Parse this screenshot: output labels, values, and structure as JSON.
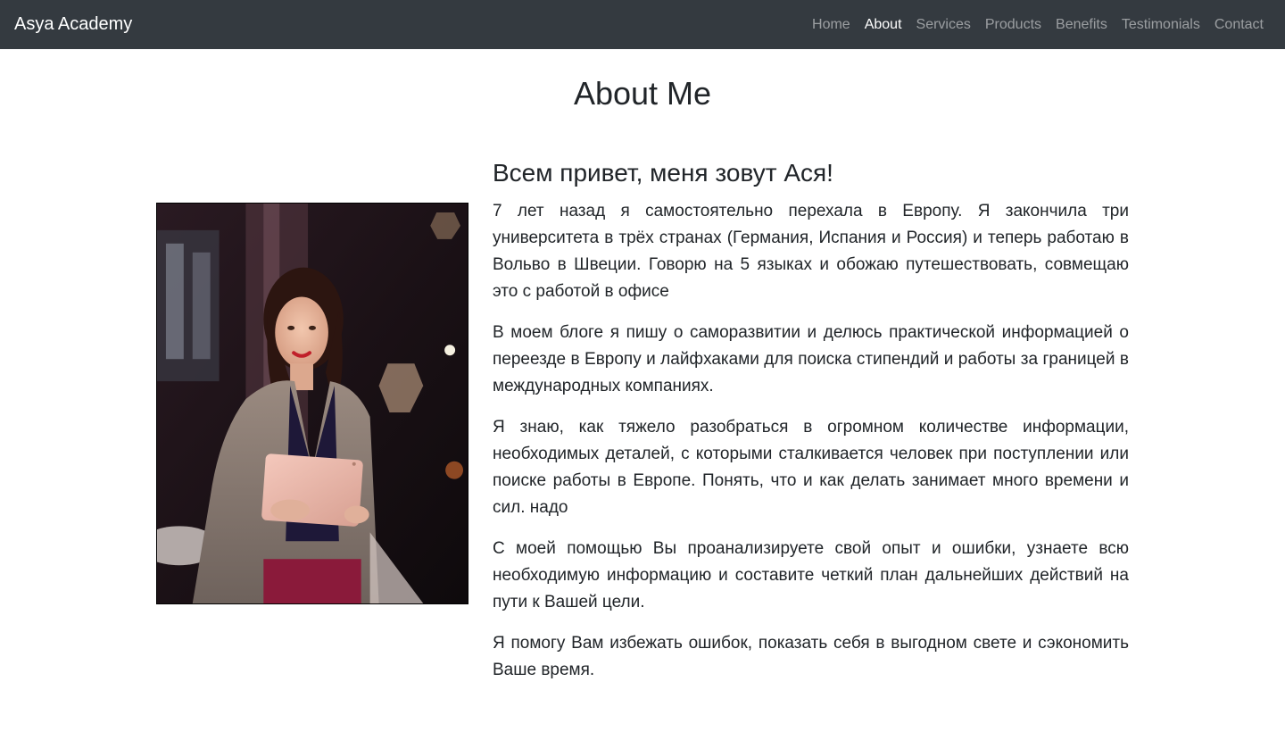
{
  "navbar": {
    "brand": "Asya Academy",
    "links": [
      {
        "label": "Home",
        "active": false
      },
      {
        "label": "About",
        "active": true
      },
      {
        "label": "Services",
        "active": false
      },
      {
        "label": "Products",
        "active": false
      },
      {
        "label": "Benefits",
        "active": false
      },
      {
        "label": "Testimonials",
        "active": false
      },
      {
        "label": "Contact",
        "active": false
      }
    ]
  },
  "about": {
    "title": "About Me",
    "greeting": "Всем привет, меня зовут Ася!",
    "paragraphs": [
      "7 лет назад я самостоятельно перехала в Европу. Я закончила три университета в трёх странах (Германия, Испания и Россия) и теперь работаю в Вольво в Швеции. Говорю на 5 языках и обожаю путешествовать, совмещаю это с работой в офисе",
      "В моем блоге я пишу о саморазвитии и делюсь практической информацией о переезде в Европу и лайфхаками для поиска стипендий и работы за границей в международных компаниях.",
      "Я знаю, как тяжело разобраться в огромном количестве информации, необходимых деталей, с которыми сталкивается человек при поступлении или поиске работы в Европе. Понять, что и как делать занимает много времени и сил. надо",
      "С моей помощью Вы проанализируете свой опыт и ошибки, узнаете всю необходимую информацию и составите четкий план дальнейших действий на пути к Вашей цели.",
      "Я помогу Вам избежать ошибок, показать себя в выгодном свете и сэкономить Ваше время."
    ]
  },
  "colors": {
    "navbar_bg": "#343a40",
    "nav_active": "#ffffff",
    "nav_inactive": "#9a9da0",
    "text": "#212529"
  }
}
